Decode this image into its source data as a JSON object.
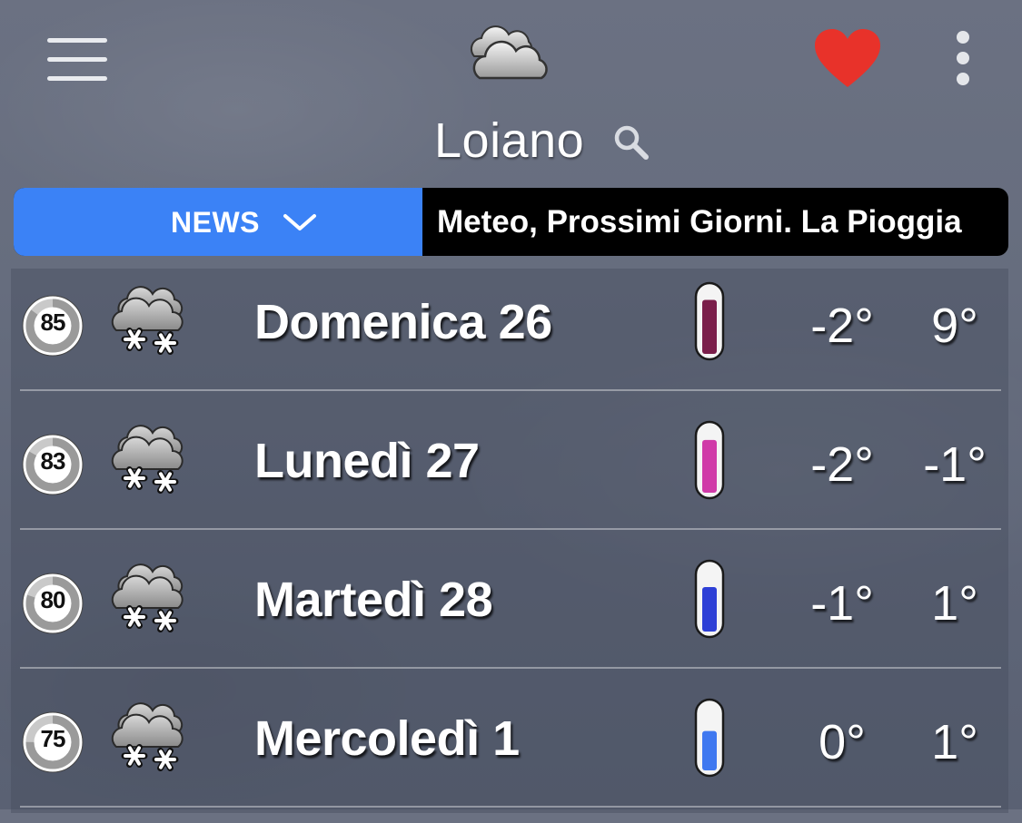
{
  "header": {
    "city": "Loiano",
    "logo_icon": "cloudy-logo-icon",
    "favorite_color": "#e8322a"
  },
  "news": {
    "label": "NEWS",
    "ticker": "Meteo, Prossimi Giorni. La Pioggia",
    "accent_color": "#3b82f6"
  },
  "forecast": [
    {
      "day": "Domenica 26",
      "score": "85",
      "score_fraction": 0.85,
      "icon": "snow-cloud-icon",
      "bar_fill": 0.85,
      "bar_color": "#7a1e4a",
      "tmin": "-2°",
      "tmax": "9°"
    },
    {
      "day": "Lunedì 27",
      "score": "83",
      "score_fraction": 0.83,
      "icon": "snow-cloud-icon",
      "bar_fill": 0.83,
      "bar_color": "#d03aa8",
      "tmin": "-2°",
      "tmax": "-1°"
    },
    {
      "day": "Martedì 28",
      "score": "80",
      "score_fraction": 0.8,
      "icon": "snow-cloud-icon",
      "bar_fill": 0.7,
      "bar_color": "#2d3fd6",
      "tmin": "-1°",
      "tmax": "1°"
    },
    {
      "day": "Mercoledì 1",
      "score": "75",
      "score_fraction": 0.75,
      "icon": "snow-cloud-icon",
      "bar_fill": 0.62,
      "bar_color": "#3f78f0",
      "tmin": "0°",
      "tmax": "1°"
    }
  ]
}
